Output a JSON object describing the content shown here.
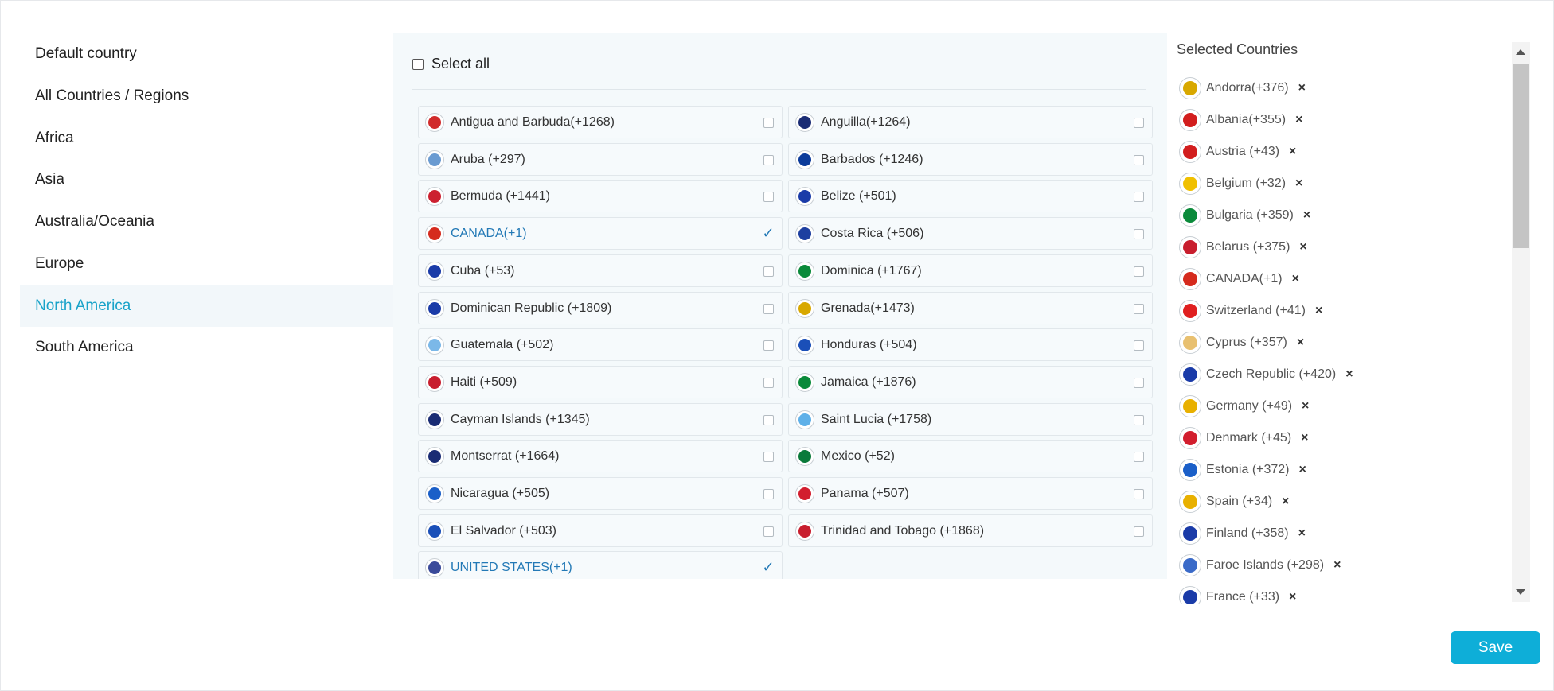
{
  "nav": {
    "items": [
      {
        "label": "Default country"
      },
      {
        "label": "All Countries / Regions"
      },
      {
        "label": "Africa"
      },
      {
        "label": "Asia"
      },
      {
        "label": "Australia/Oceania"
      },
      {
        "label": "Europe"
      },
      {
        "label": "North America",
        "active": true
      },
      {
        "label": "South America"
      }
    ]
  },
  "middle": {
    "select_all_label": "Select all",
    "countries": [
      {
        "name": "Antigua and Barbuda(+1268)",
        "checked": false,
        "color": "#d12c2c"
      },
      {
        "name": "Anguilla(+1264)",
        "checked": false,
        "color": "#1a2c74"
      },
      {
        "name": "Aruba (+297)",
        "checked": false,
        "color": "#6a9bd1"
      },
      {
        "name": "Barbados (+1246)",
        "checked": false,
        "color": "#0b3b9a"
      },
      {
        "name": "Bermuda (+1441)",
        "checked": false,
        "color": "#cc2030"
      },
      {
        "name": "Belize (+501)",
        "checked": false,
        "color": "#1a3ba8"
      },
      {
        "name": "CANADA(+1)",
        "checked": true,
        "color": "#d52b1e"
      },
      {
        "name": "Costa Rica (+506)",
        "checked": false,
        "color": "#1d3fa0"
      },
      {
        "name": "Cuba (+53)",
        "checked": false,
        "color": "#1a3ba8"
      },
      {
        "name": "Dominica (+1767)",
        "checked": false,
        "color": "#0a8a3a"
      },
      {
        "name": "Dominican Republic (+1809)",
        "checked": false,
        "color": "#1a3ba8"
      },
      {
        "name": "Grenada(+1473)",
        "checked": false,
        "color": "#d8a800"
      },
      {
        "name": "Guatemala (+502)",
        "checked": false,
        "color": "#7bb8e8"
      },
      {
        "name": "Honduras (+504)",
        "checked": false,
        "color": "#1a4fb8"
      },
      {
        "name": "Haiti (+509)",
        "checked": false,
        "color": "#c81e2e"
      },
      {
        "name": "Jamaica (+1876)",
        "checked": false,
        "color": "#0a8a3a"
      },
      {
        "name": "Cayman Islands (+1345)",
        "checked": false,
        "color": "#1a2c74"
      },
      {
        "name": "Saint Lucia (+1758)",
        "checked": false,
        "color": "#5fb0e8"
      },
      {
        "name": "Montserrat (+1664)",
        "checked": false,
        "color": "#1a2c74"
      },
      {
        "name": "Mexico (+52)",
        "checked": false,
        "color": "#0a7a3a"
      },
      {
        "name": "Nicaragua (+505)",
        "checked": false,
        "color": "#1a5fc8"
      },
      {
        "name": "Panama (+507)",
        "checked": false,
        "color": "#d21e2e"
      },
      {
        "name": "El Salvador (+503)",
        "checked": false,
        "color": "#1a4fb8"
      },
      {
        "name": "Trinidad and Tobago (+1868)",
        "checked": false,
        "color": "#c81e2e"
      },
      {
        "name": "UNITED STATES(+1)",
        "checked": true,
        "color": "#3a4a9a"
      }
    ]
  },
  "right": {
    "title": "Selected Countries",
    "remove_symbol": "×",
    "selected": [
      {
        "name": "Andorra(+376)",
        "color": "#d8a800"
      },
      {
        "name": "Albania(+355)",
        "color": "#d21e1e"
      },
      {
        "name": "Austria (+43)",
        "color": "#d21e1e"
      },
      {
        "name": "Belgium (+32)",
        "color": "#f0c000"
      },
      {
        "name": "Bulgaria (+359)",
        "color": "#0a8a3a"
      },
      {
        "name": "Belarus (+375)",
        "color": "#c81e2e"
      },
      {
        "name": "CANADA(+1)",
        "color": "#d52b1e"
      },
      {
        "name": "Switzerland (+41)",
        "color": "#e02020"
      },
      {
        "name": "Cyprus (+357)",
        "color": "#e8c070"
      },
      {
        "name": "Czech Republic (+420)",
        "color": "#1a3ba8"
      },
      {
        "name": "Germany (+49)",
        "color": "#e8b000"
      },
      {
        "name": "Denmark (+45)",
        "color": "#d21e2e"
      },
      {
        "name": "Estonia (+372)",
        "color": "#1a5fc8"
      },
      {
        "name": "Spain (+34)",
        "color": "#e8b000"
      },
      {
        "name": "Finland (+358)",
        "color": "#1a3ba8"
      },
      {
        "name": "Faroe Islands (+298)",
        "color": "#3a6ac8"
      },
      {
        "name": "France (+33)",
        "color": "#1a3ba8"
      }
    ]
  },
  "save_label": "Save",
  "checkmark": "✓"
}
